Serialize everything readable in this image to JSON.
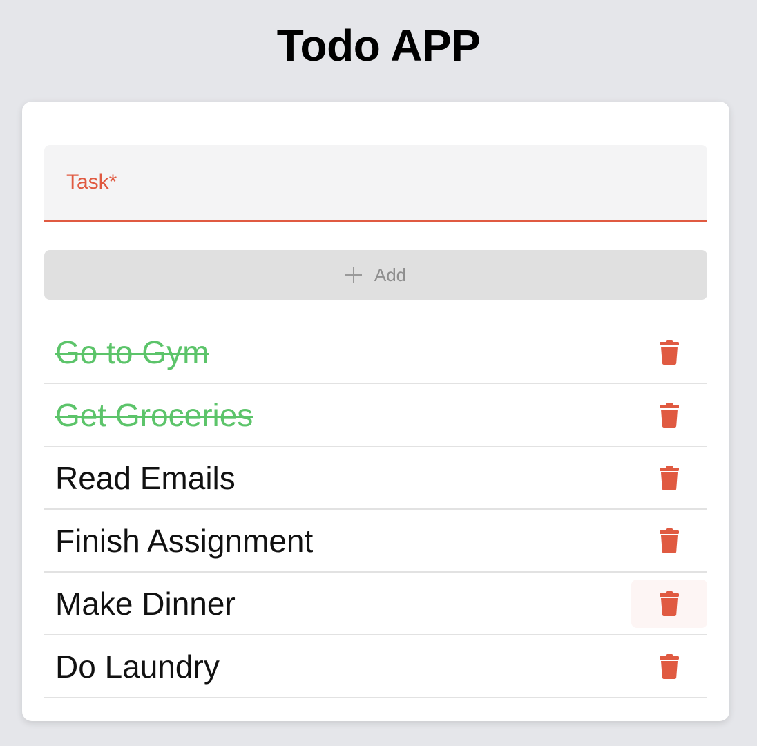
{
  "app": {
    "title": "Todo APP"
  },
  "form": {
    "task_label": "Task*",
    "task_value": "",
    "add_label": "Add",
    "add_icon": "plus-icon"
  },
  "colors": {
    "background": "#e5e6ea",
    "card": "#ffffff",
    "accent_error": "#e05a41",
    "completed_text": "#5cc46a",
    "delete_icon": "#e05a41",
    "add_button_bg": "#e0e0e0"
  },
  "todos": [
    {
      "text": "Go to Gym",
      "completed": true
    },
    {
      "text": "Get Groceries",
      "completed": true
    },
    {
      "text": "Read Emails",
      "completed": false
    },
    {
      "text": "Finish Assignment",
      "completed": false
    },
    {
      "text": "Make Dinner",
      "completed": false,
      "hovered": true
    },
    {
      "text": "Do Laundry",
      "completed": false
    }
  ],
  "delete_icon": "trash-icon"
}
